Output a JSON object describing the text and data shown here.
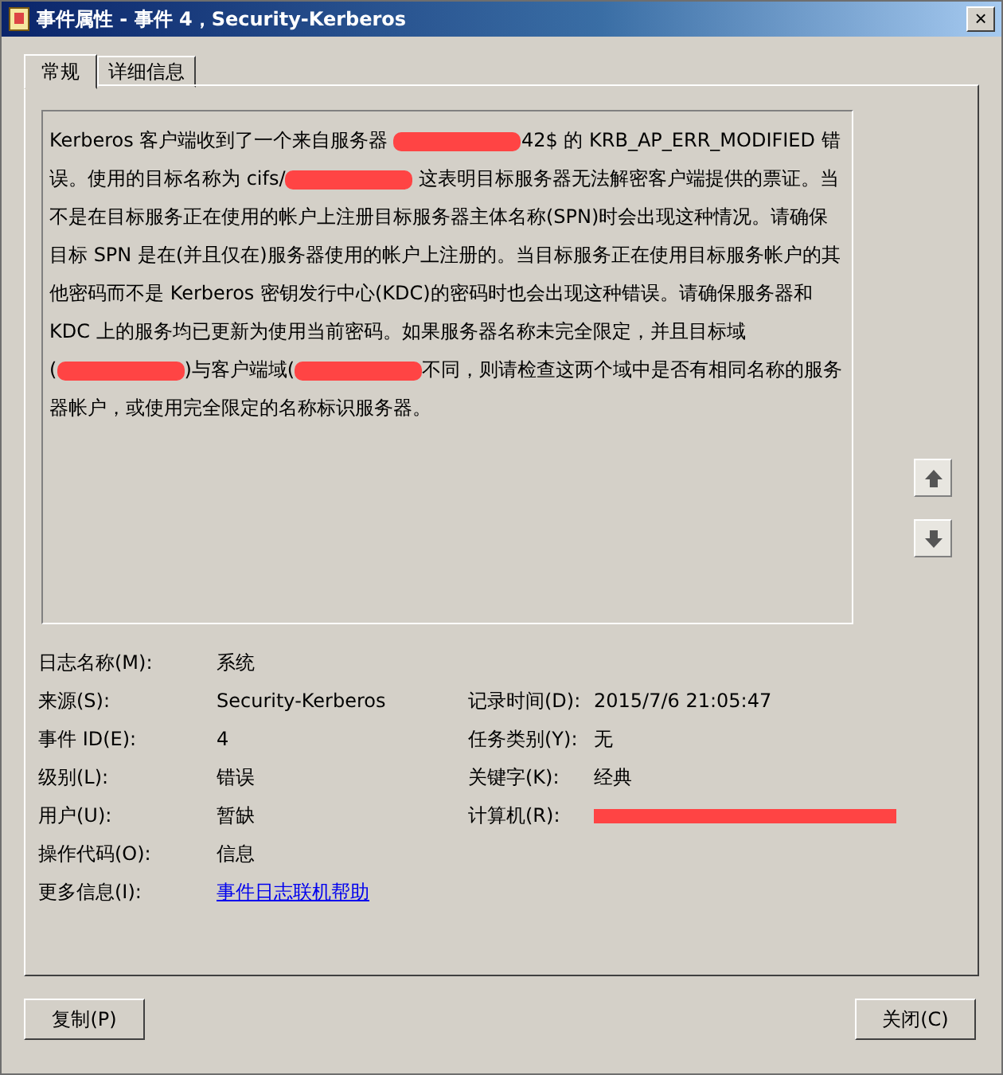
{
  "window": {
    "title": "事件属性 - 事件 4，Security-Kerberos",
    "close": "×"
  },
  "tabs": [
    {
      "label": "常规",
      "selected": true
    },
    {
      "label": "详细信息",
      "selected": false
    }
  ],
  "description": [
    {
      "kind": "text",
      "text": "Kerberos 客户端收到了一个来自服务器 "
    },
    {
      "kind": "redaction"
    },
    {
      "kind": "text",
      "text": "42$ 的 KRB_AP_ERR_MODIFIED 错误。使用的目标名称为 cifs/"
    },
    {
      "kind": "redaction"
    },
    {
      "kind": "text",
      "text": " 这表明目标服务器无法解密客户端提供的票证。当不是在目标服务正在使用的帐户上注册目标服务器主体名称(SPN)时会出现这种情况。请确保目标 SPN 是在(并且仅在)服务器使用的帐户上注册的。当目标服务正在使用目标服务帐户的其他密码而不是 Kerberos 密钥发行中心(KDC)的密码时也会出现这种错误。请确保服务器和 KDC 上的服务均已更新为使用当前密码。如果服务器名称未完全限定，并且目标域\n("
    },
    {
      "kind": "redaction"
    },
    {
      "kind": "text",
      "text": ")与客户端域("
    },
    {
      "kind": "redaction"
    },
    {
      "kind": "text",
      "text": "不同，则请检查这两个域中是否有相同名称的服务器帐户，或使用完全限定的名称标识服务器。"
    }
  ],
  "fields": [
    {
      "label": "日志名称(M):",
      "value": "系统",
      "kind": "text"
    },
    {
      "label": "来源(S):",
      "value": "Security-Kerberos",
      "kind": "text",
      "right_label": "记录时间(D):",
      "right_value": "2015/7/6 21:05:47",
      "right_redacted": false
    },
    {
      "label": "事件 ID(E):",
      "value": "4",
      "kind": "text",
      "right_label": "任务类别(Y):",
      "right_value": "无",
      "right_redacted": false
    },
    {
      "label": "级别(L):",
      "value": "错误",
      "kind": "text",
      "right_label": "关键字(K):",
      "right_value": "经典",
      "right_redacted": false
    },
    {
      "label": "用户(U):",
      "value": "暂缺",
      "kind": "text",
      "right_label": "计算机(R):",
      "right_redacted": true
    },
    {
      "label": "操作代码(O):",
      "value": "信息",
      "kind": "text"
    },
    {
      "label": "更多信息(I):",
      "value": "事件日志联机帮助",
      "kind": "link"
    }
  ],
  "buttons": [
    {
      "label": "复制(P)"
    },
    {
      "label": "关闭(C)"
    }
  ]
}
